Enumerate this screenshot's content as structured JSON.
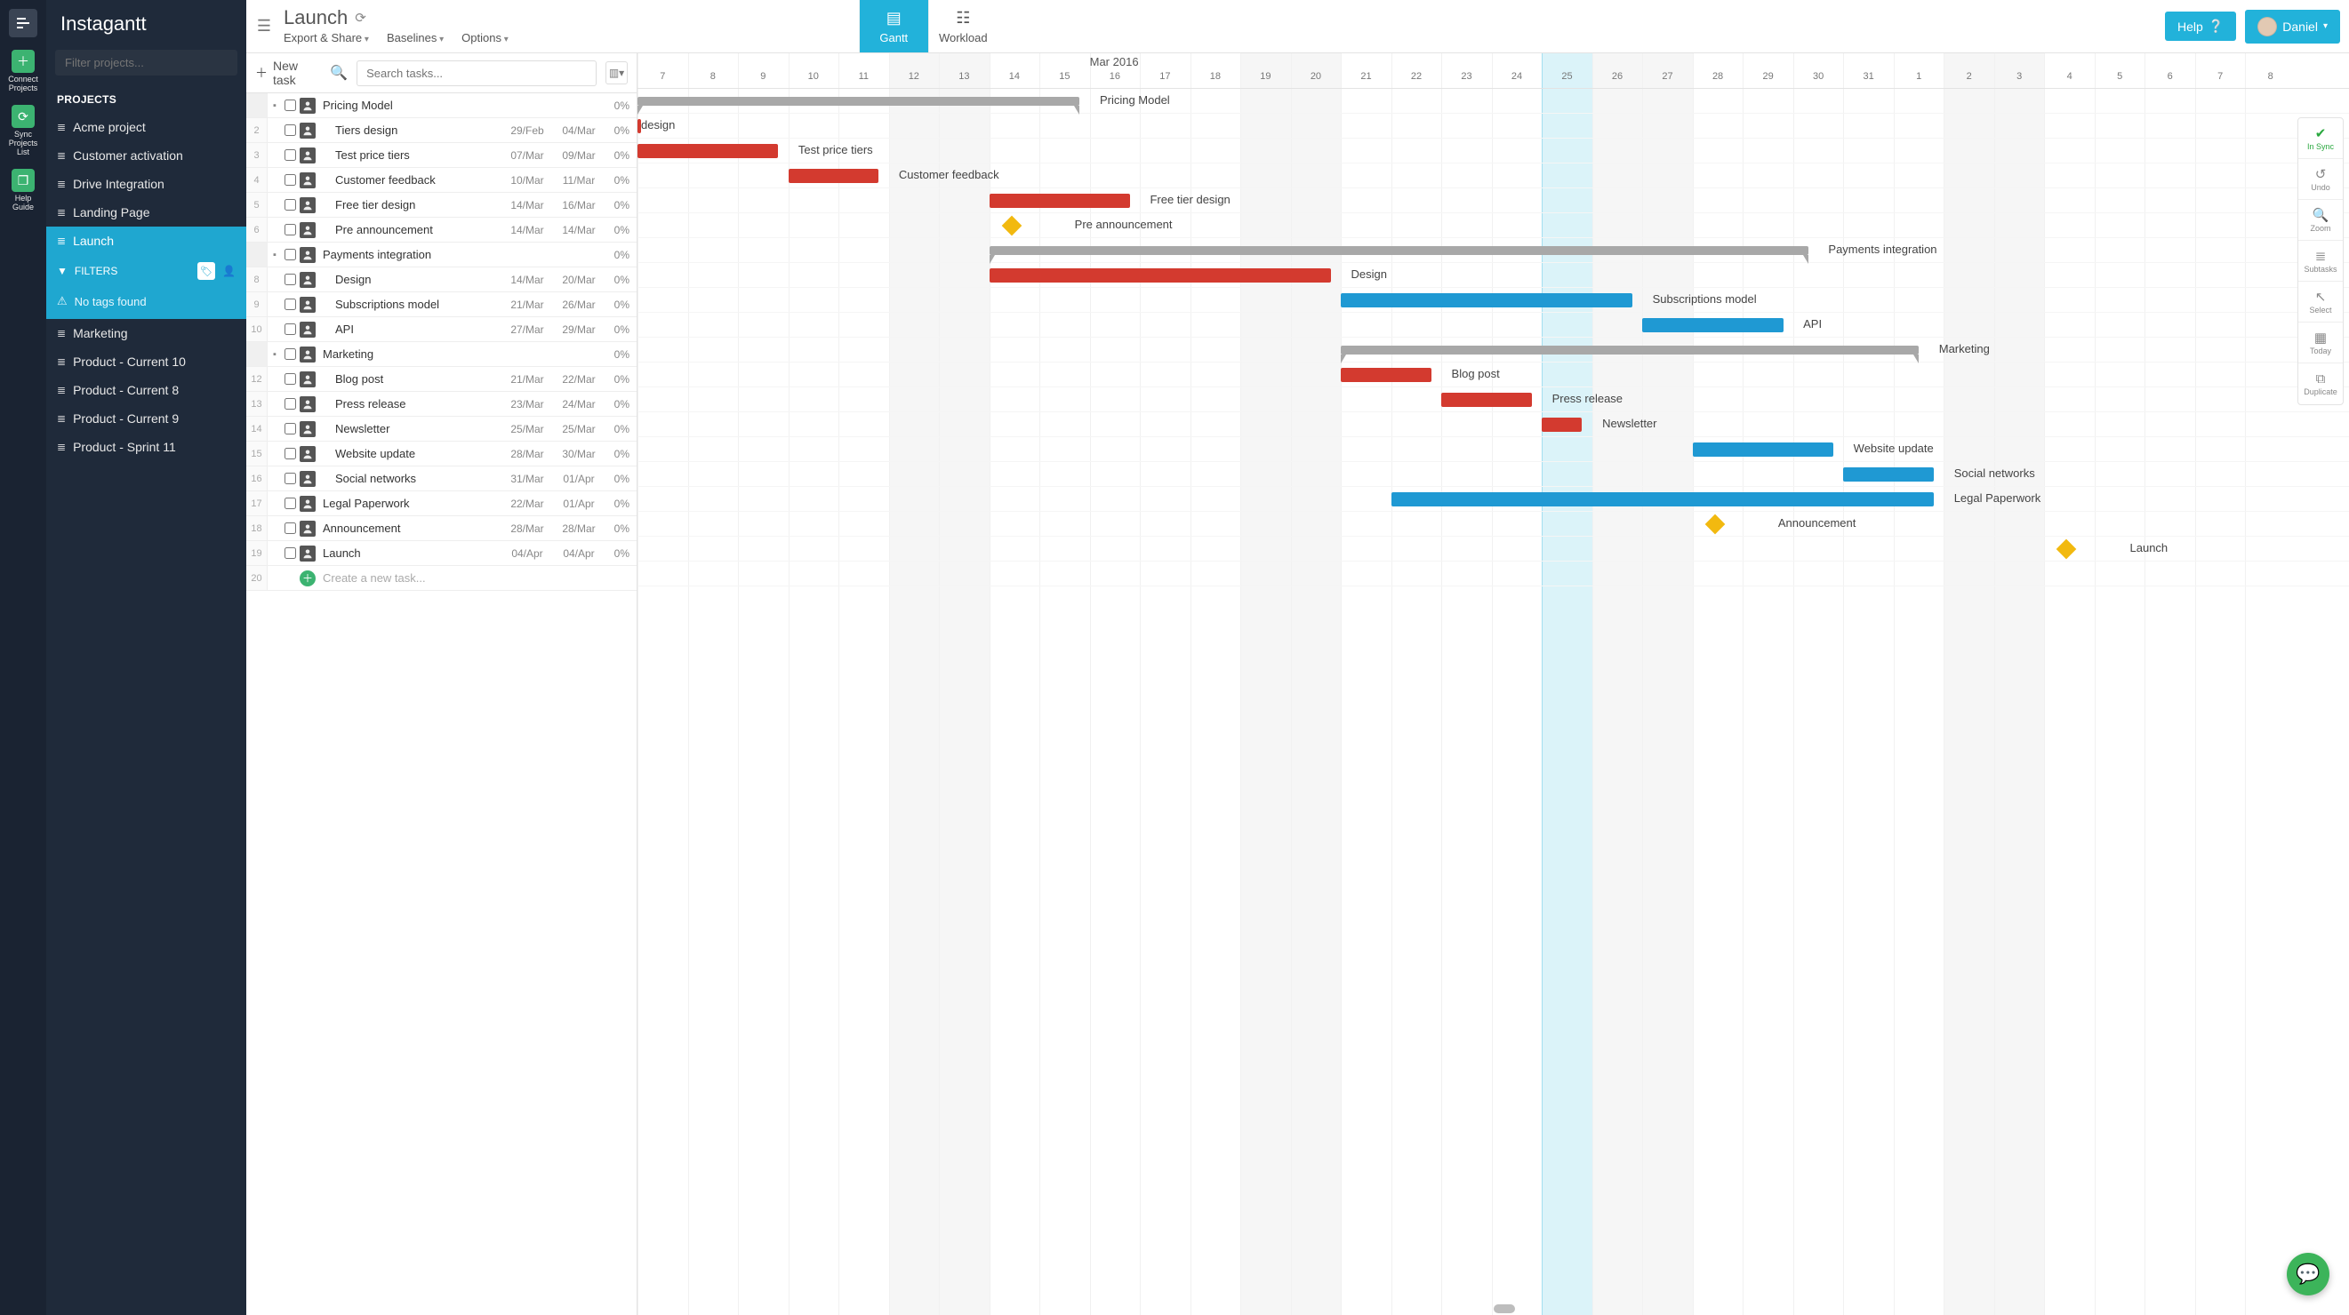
{
  "app": {
    "brand": "Instagantt"
  },
  "rail": {
    "connect": "Connect Projects",
    "sync": "Sync Projects List",
    "help": "Help Guide"
  },
  "sidebar": {
    "filter_placeholder": "Filter projects...",
    "projects_label": "PROJECTS",
    "projects": [
      {
        "name": "Acme project",
        "active": false
      },
      {
        "name": "Customer activation",
        "active": false
      },
      {
        "name": "Drive Integration",
        "active": false
      },
      {
        "name": "Landing Page",
        "active": false
      },
      {
        "name": "Launch",
        "active": true
      },
      {
        "name": "Marketing",
        "active": false
      },
      {
        "name": "Product - Current 10",
        "active": false
      },
      {
        "name": "Product - Current 8",
        "active": false
      },
      {
        "name": "Product - Current 9",
        "active": false
      },
      {
        "name": "Product - Sprint 11",
        "active": false
      }
    ],
    "filters_label": "FILTERS",
    "no_tags": "No tags found"
  },
  "header": {
    "title": "Launch",
    "menus": {
      "export": "Export & Share",
      "baselines": "Baselines",
      "options": "Options"
    },
    "tabs": {
      "gantt": "Gantt",
      "workload": "Workload"
    },
    "help": "Help",
    "user": "Daniel"
  },
  "toolbar": {
    "new_task": "New task",
    "search_placeholder": "Search tasks..."
  },
  "timeline": {
    "month": "Mar 2016",
    "start_day_index": 7,
    "days": [
      "7",
      "8",
      "9",
      "10",
      "11",
      "12",
      "13",
      "14",
      "15",
      "16",
      "17",
      "18",
      "19",
      "20",
      "21",
      "22",
      "23",
      "24",
      "25",
      "26",
      "27",
      "28",
      "29",
      "30",
      "31",
      "1",
      "2",
      "3",
      "4",
      "5",
      "6",
      "7",
      "8"
    ],
    "weekend_idx": [
      5,
      6,
      12,
      13,
      19,
      20,
      26,
      27
    ],
    "today_idx": 18
  },
  "tasks": [
    {
      "n": "",
      "type": "group",
      "name": "Pricing Model",
      "pct": "0%",
      "bar": {
        "kind": "grey",
        "s": -0.5,
        "e": 8.8,
        "label_side": "right"
      }
    },
    {
      "n": "2",
      "type": "task",
      "indent": 1,
      "name": "Tiers design",
      "d1": "29/Feb",
      "d2": "04/Mar",
      "pct": "0%",
      "bar": {
        "kind": "red",
        "s": -3,
        "e": -2,
        "label": "design",
        "label_side": "right-near"
      }
    },
    {
      "n": "3",
      "type": "task",
      "indent": 1,
      "name": "Test price tiers",
      "d1": "07/Mar",
      "d2": "09/Mar",
      "pct": "0%",
      "bar": {
        "kind": "red",
        "s": 0,
        "e": 2.8,
        "label_side": "right"
      }
    },
    {
      "n": "4",
      "type": "task",
      "indent": 1,
      "name": "Customer feedback",
      "d1": "10/Mar",
      "d2": "11/Mar",
      "pct": "0%",
      "bar": {
        "kind": "red",
        "s": 3,
        "e": 4.8,
        "label_side": "right"
      }
    },
    {
      "n": "5",
      "type": "task",
      "indent": 1,
      "name": "Free tier design",
      "d1": "14/Mar",
      "d2": "16/Mar",
      "pct": "0%",
      "bar": {
        "kind": "red",
        "s": 7,
        "e": 9.8,
        "label_side": "right"
      }
    },
    {
      "n": "6",
      "type": "task",
      "indent": 1,
      "name": "Pre announcement",
      "d1": "14/Mar",
      "d2": "14/Mar",
      "pct": "0%",
      "bar": {
        "kind": "mile",
        "s": 7.3,
        "label_side": "right"
      }
    },
    {
      "n": "",
      "type": "group",
      "name": "Payments integration",
      "pct": "0%",
      "bar": {
        "kind": "grey",
        "s": 7,
        "e": 23.3,
        "label_side": "right"
      }
    },
    {
      "n": "8",
      "type": "task",
      "indent": 1,
      "name": "Design",
      "d1": "14/Mar",
      "d2": "20/Mar",
      "pct": "0%",
      "bar": {
        "kind": "red",
        "s": 7,
        "e": 13.8,
        "label_side": "right"
      }
    },
    {
      "n": "9",
      "type": "task",
      "indent": 1,
      "name": "Subscriptions model",
      "d1": "21/Mar",
      "d2": "26/Mar",
      "pct": "0%",
      "bar": {
        "kind": "blue",
        "s": 14,
        "e": 19.8,
        "label_side": "right"
      }
    },
    {
      "n": "10",
      "type": "task",
      "indent": 1,
      "name": "API",
      "d1": "27/Mar",
      "d2": "29/Mar",
      "pct": "0%",
      "bar": {
        "kind": "blue",
        "s": 20,
        "e": 22.8,
        "label_side": "right"
      }
    },
    {
      "n": "",
      "type": "group",
      "name": "Marketing",
      "pct": "0%",
      "bar": {
        "kind": "grey",
        "s": 14,
        "e": 25.5,
        "label_side": "right"
      }
    },
    {
      "n": "12",
      "type": "task",
      "indent": 1,
      "name": "Blog post",
      "d1": "21/Mar",
      "d2": "22/Mar",
      "pct": "0%",
      "bar": {
        "kind": "red",
        "s": 14,
        "e": 15.8,
        "label_side": "right"
      }
    },
    {
      "n": "13",
      "type": "task",
      "indent": 1,
      "name": "Press release",
      "d1": "23/Mar",
      "d2": "24/Mar",
      "pct": "0%",
      "bar": {
        "kind": "red",
        "s": 16,
        "e": 17.8,
        "label_side": "right"
      }
    },
    {
      "n": "14",
      "type": "task",
      "indent": 1,
      "name": "Newsletter",
      "d1": "25/Mar",
      "d2": "25/Mar",
      "pct": "0%",
      "bar": {
        "kind": "red",
        "s": 18,
        "e": 18.8,
        "label_side": "right"
      }
    },
    {
      "n": "15",
      "type": "task",
      "indent": 1,
      "name": "Website update",
      "d1": "28/Mar",
      "d2": "30/Mar",
      "pct": "0%",
      "bar": {
        "kind": "blue",
        "s": 21,
        "e": 23.8,
        "label_side": "right"
      }
    },
    {
      "n": "16",
      "type": "task",
      "indent": 1,
      "name": "Social networks",
      "d1": "31/Mar",
      "d2": "01/Apr",
      "pct": "0%",
      "bar": {
        "kind": "blue",
        "s": 24,
        "e": 25.8,
        "label_side": "right"
      }
    },
    {
      "n": "17",
      "type": "task",
      "name": "Legal Paperwork",
      "d1": "22/Mar",
      "d2": "01/Apr",
      "pct": "0%",
      "bar": {
        "kind": "blue",
        "s": 15,
        "e": 25.8,
        "label_side": "right"
      }
    },
    {
      "n": "18",
      "type": "task",
      "name": "Announcement",
      "d1": "28/Mar",
      "d2": "28/Mar",
      "pct": "0%",
      "bar": {
        "kind": "mile",
        "s": 21.3,
        "label_side": "right"
      }
    },
    {
      "n": "19",
      "type": "task",
      "name": "Launch",
      "d1": "04/Apr",
      "d2": "04/Apr",
      "pct": "0%",
      "bar": {
        "kind": "mile",
        "s": 28.3,
        "label_side": "right"
      }
    },
    {
      "n": "20",
      "type": "new",
      "name": "Create a new task..."
    }
  ],
  "toolbox": {
    "sync": "In Sync",
    "undo": "Undo",
    "zoom": "Zoom",
    "subtasks": "Subtasks",
    "select": "Select",
    "today": "Today",
    "duplicate": "Duplicate"
  }
}
